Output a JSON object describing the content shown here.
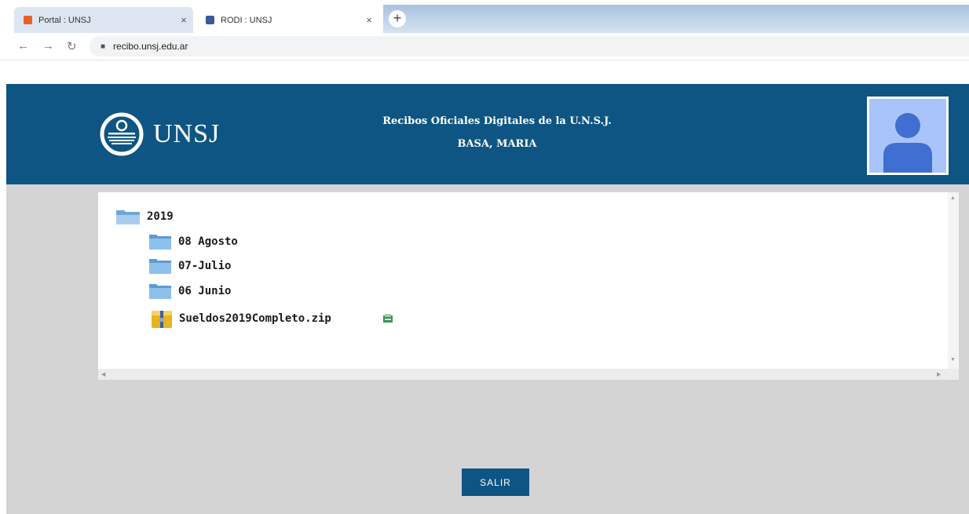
{
  "browser": {
    "tabs": [
      {
        "title": "Portal : UNSJ",
        "favicon_color": "#e8612c"
      },
      {
        "title": "RODI : UNSJ",
        "favicon_color": "#3a5a9c"
      }
    ],
    "address": "recibo.unsj.edu.ar"
  },
  "header": {
    "logo_text": "UNSJ",
    "title_line1": "Recibos Oficiales Digitales de la U.N.S.J.",
    "title_line2": "BASA, MARIA"
  },
  "tree": {
    "root": "2019",
    "folders": [
      "08 Agosto",
      "07-Julio",
      "06 Junio"
    ],
    "file": "Sueldos2019Completo.zip"
  },
  "actions": {
    "exit_label": "SALIR"
  },
  "colors": {
    "header_bg": "#0e5583",
    "content_bg": "#d4d4d4",
    "avatar_bg": "#a8c4fb",
    "avatar_figure": "#3f6fd1"
  }
}
